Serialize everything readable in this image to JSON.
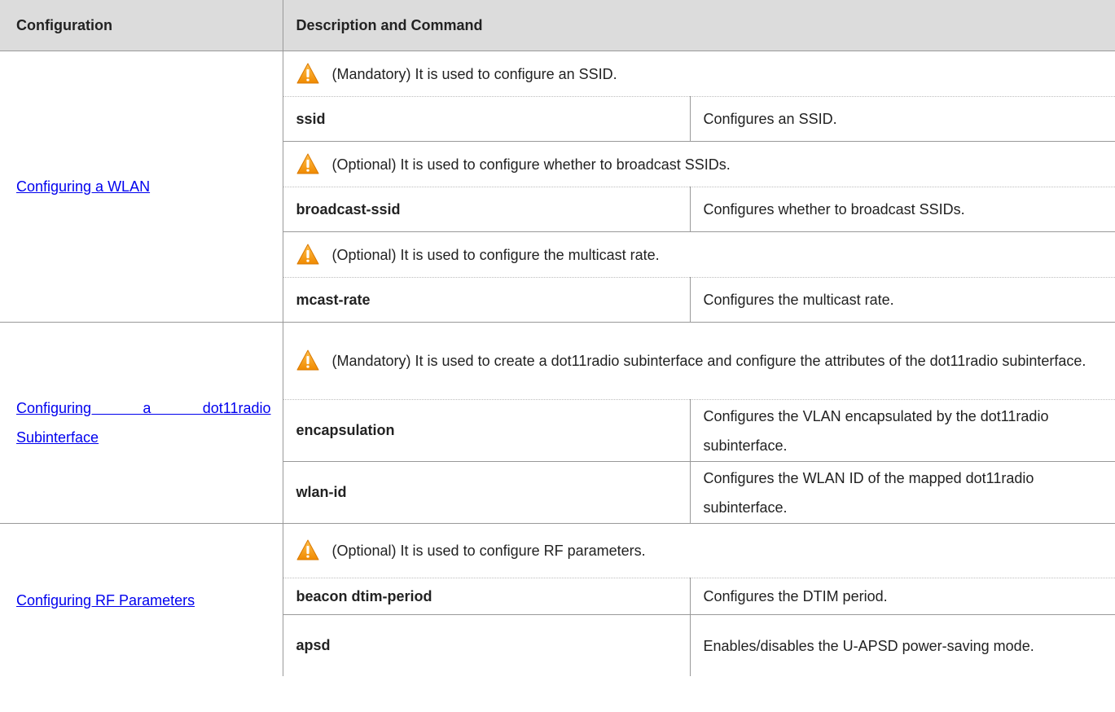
{
  "header": {
    "col1": "Configuration",
    "col2": "Description and Command"
  },
  "colors": {
    "header_bg": "#dcdcdc",
    "link": "#0000ee",
    "warning": "#f5a623"
  },
  "sections": [
    {
      "config_link_lines": [
        "Configuring a WLAN"
      ],
      "note1": "(Mandatory) It is used to configure an SSID.",
      "cmd1": "ssid",
      "desc1": "Configures an SSID.",
      "note2": "(Optional) It is used to configure whether to broadcast SSIDs.",
      "cmd2": "broadcast-ssid",
      "desc2": "Configures whether to broadcast SSIDs.",
      "note3": "(Optional) It is used to configure the multicast rate.",
      "cmd3": "mcast-rate",
      "desc3": "Configures the multicast rate."
    },
    {
      "config_link_line1": "Configuring a dot11radio",
      "config_link_line2": "Subinterface",
      "note1": "(Mandatory) It is used to create a dot11radio subinterface and configure the attributes of the dot11radio subinterface.",
      "cmd1": "encapsulation",
      "desc1": "Configures the VLAN encapsulated by the dot11radio subinterface.",
      "cmd2": "wlan-id",
      "desc2": "Configures the WLAN ID of the mapped dot11radio subinterface."
    },
    {
      "config_link": "Configuring RF Parameters",
      "note1": "(Optional) It is used to configure RF parameters.",
      "cmd1": "beacon dtim-period",
      "desc1": "Configures the DTIM period.",
      "cmd2": "apsd",
      "desc2": "Enables/disables the U-APSD power-saving mode."
    }
  ],
  "icons": {
    "warning": "warning-triangle-icon"
  }
}
